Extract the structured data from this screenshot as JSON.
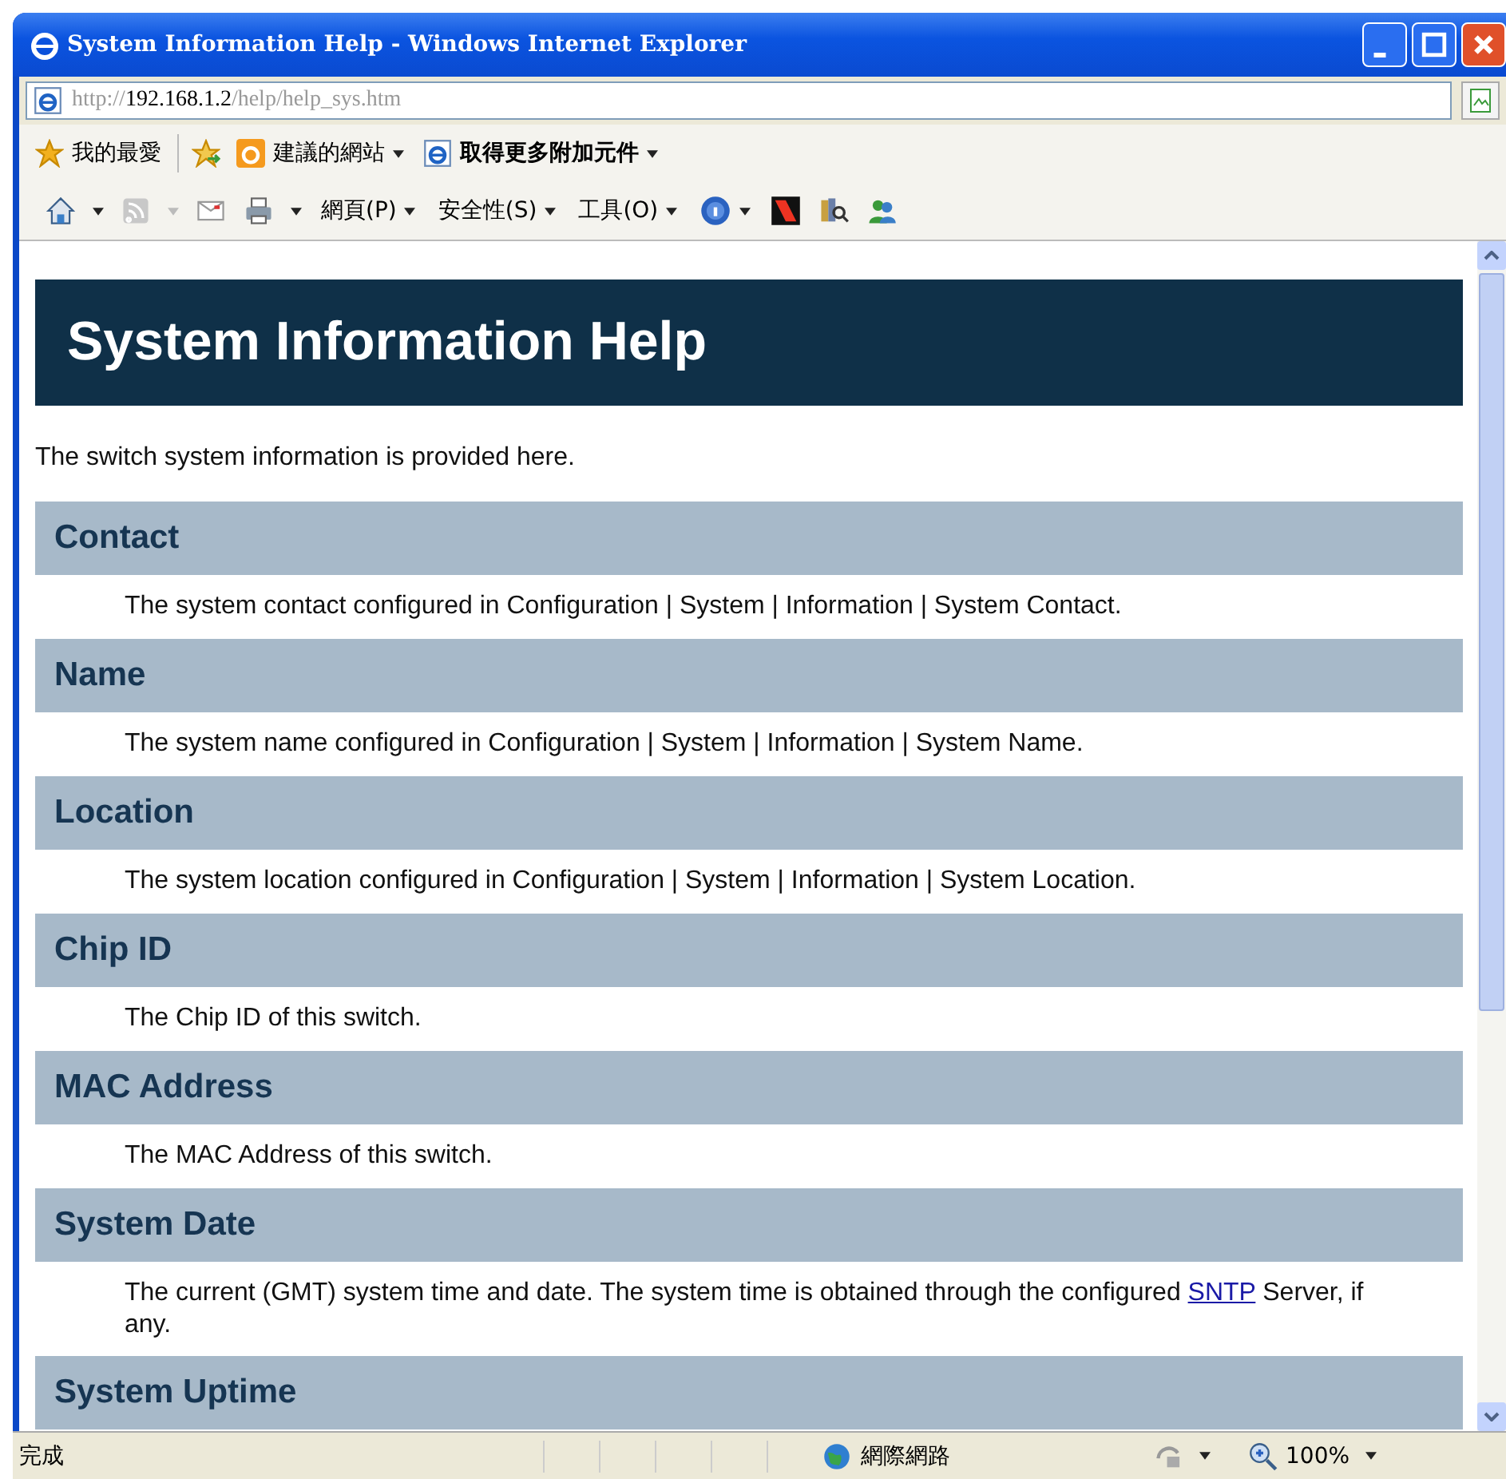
{
  "window": {
    "title": "System Information Help - Windows Internet Explorer"
  },
  "address": {
    "scheme": "http://",
    "host": "192.168.1.2",
    "path": "/help/help_sys.htm"
  },
  "favorites_bar": {
    "favorites": "我的最愛",
    "items": [
      {
        "label": "建議的網站",
        "kind": "suggested"
      },
      {
        "label": "取得更多附加元件",
        "kind": "addons"
      }
    ]
  },
  "command_bar": {
    "menus": [
      "網頁(P)",
      "安全性(S)",
      "工具(O)"
    ]
  },
  "page": {
    "title": "System Information Help",
    "intro": "The switch system information is provided here.",
    "sections": [
      {
        "heading": "Contact",
        "text": "The system contact configured in Configuration | System | Information | System Contact."
      },
      {
        "heading": "Name",
        "text": "The system name configured in Configuration | System | Information | System Name."
      },
      {
        "heading": "Location",
        "text": "The system location configured in Configuration | System | Information | System Location."
      },
      {
        "heading": "Chip ID",
        "text": "The Chip ID of this switch."
      },
      {
        "heading": "MAC Address",
        "text": "The MAC Address of this switch."
      },
      {
        "heading": "System Date",
        "text": "The current (GMT) system time and date. The system time is obtained through the configured ",
        "link": "SNTP",
        "after": " Server, if any."
      },
      {
        "heading": "System Uptime"
      }
    ]
  },
  "status_bar": {
    "status": "完成",
    "zone": "網際網路",
    "zoom": "100%"
  }
}
